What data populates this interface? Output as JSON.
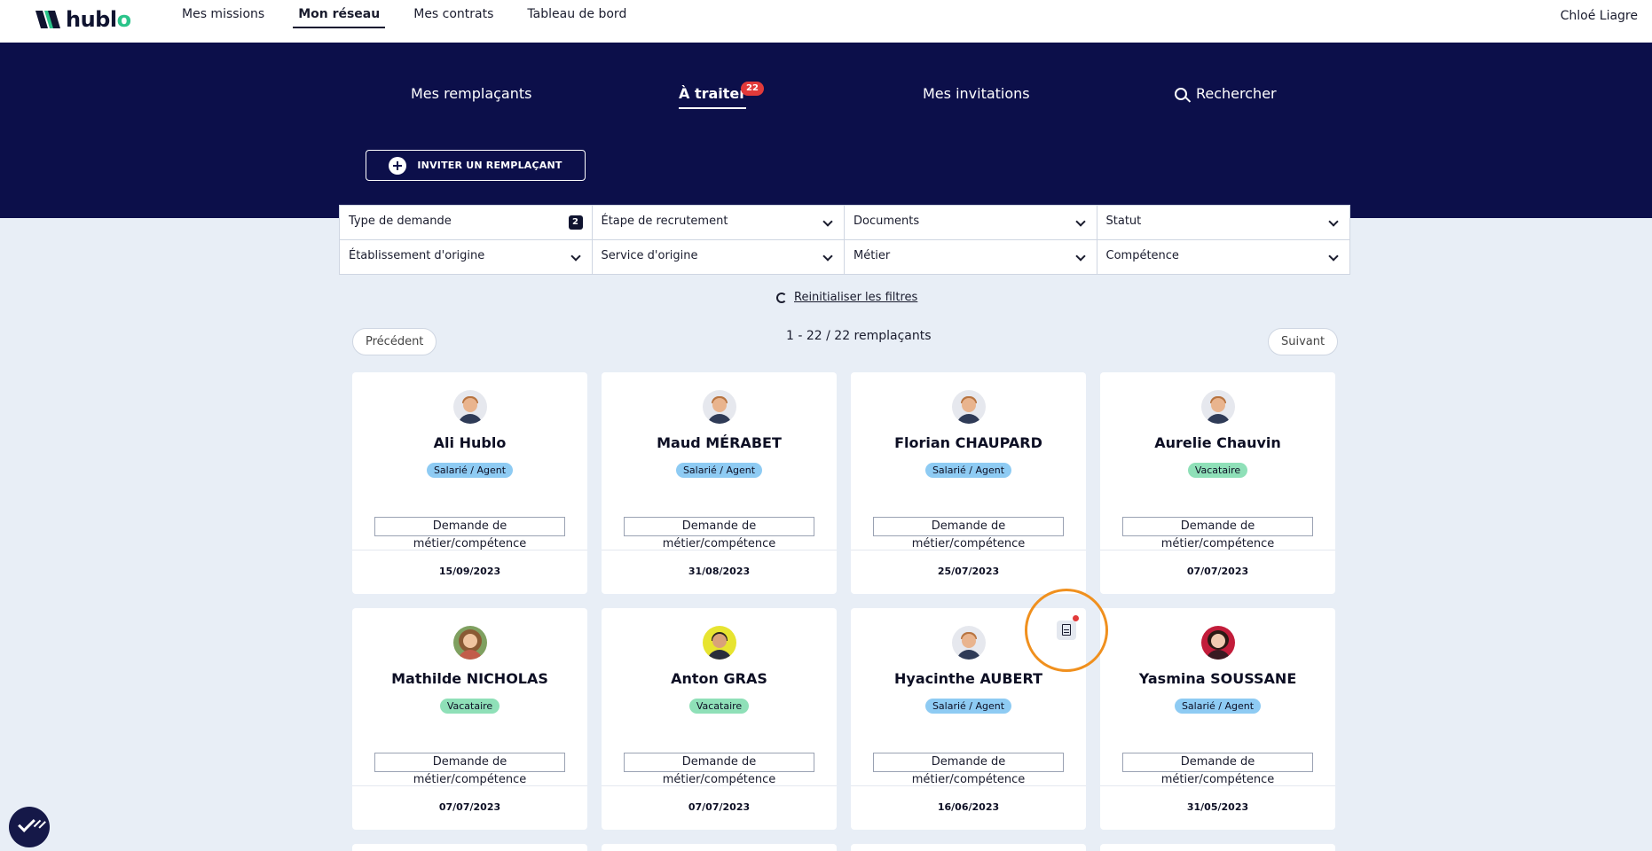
{
  "app": {
    "logo_text_start": "hubl",
    "logo_text_end": "o",
    "brand_accent": "#2bc48a",
    "header_bg": "#0c0f4a"
  },
  "topnav": {
    "items": [
      {
        "label": "Mes missions",
        "active": false
      },
      {
        "label": "Mon réseau",
        "active": true
      },
      {
        "label": "Mes contrats",
        "active": false
      },
      {
        "label": "Tableau de bord",
        "active": false
      }
    ],
    "user": "Chloé Liagre"
  },
  "tabs": [
    {
      "label": "Mes remplaçants",
      "active": false
    },
    {
      "label": "À traiter",
      "active": true,
      "badge": "22"
    },
    {
      "label": "Mes invitations",
      "active": false
    },
    {
      "label": "Rechercher",
      "active": false,
      "icon": "search-icon"
    }
  ],
  "invite_button": "INVITER UN REMPLAÇANT",
  "filters": [
    {
      "label": "Type de demande",
      "count": "2"
    },
    {
      "label": "Étape de recrutement"
    },
    {
      "label": "Documents"
    },
    {
      "label": "Statut"
    },
    {
      "label": "Établissement d'origine"
    },
    {
      "label": "Service d'origine"
    },
    {
      "label": "Métier"
    },
    {
      "label": "Compétence"
    }
  ],
  "reset_filters": "Reinitialiser les filtres",
  "pagination": {
    "previous": "Précédent",
    "next": "Suivant",
    "summary": "1 - 22 / 22 remplaçants"
  },
  "cards": [
    {
      "name": "Ali Hublo",
      "status": "Salarié / Agent",
      "status_type": "agent",
      "request": "Demande de métier/compétence",
      "date": "15/09/2023",
      "avatar": "default"
    },
    {
      "name": "Maud MÉRABET",
      "status": "Salarié / Agent",
      "status_type": "agent",
      "request": "Demande de métier/compétence",
      "date": "31/08/2023",
      "avatar": "default"
    },
    {
      "name": "Florian CHAUPARD",
      "status": "Salarié / Agent",
      "status_type": "agent",
      "request": "Demande de métier/compétence",
      "date": "25/07/2023",
      "avatar": "default"
    },
    {
      "name": "Aurelie Chauvin",
      "status": "Vacataire",
      "status_type": "vacataire",
      "request": "Demande de métier/compétence",
      "date": "07/07/2023",
      "avatar": "default"
    },
    {
      "name": "Mathilde NICHOLAS",
      "status": "Vacataire",
      "status_type": "vacataire",
      "request": "Demande de métier/compétence",
      "date": "07/07/2023",
      "avatar": "photo1"
    },
    {
      "name": "Anton GRAS",
      "status": "Vacataire",
      "status_type": "vacataire",
      "request": "Demande de métier/compétence",
      "date": "07/07/2023",
      "avatar": "photo2"
    },
    {
      "name": "Hyacinthe AUBERT",
      "status": "Salarié / Agent",
      "status_type": "agent",
      "request": "Demande de métier/compétence",
      "date": "16/06/2023",
      "avatar": "default"
    },
    {
      "name": "Yasmina SOUSSANE",
      "status": "Salarié / Agent",
      "status_type": "agent",
      "request": "Demande de métier/compétence",
      "date": "31/05/2023",
      "avatar": "photo3"
    }
  ]
}
